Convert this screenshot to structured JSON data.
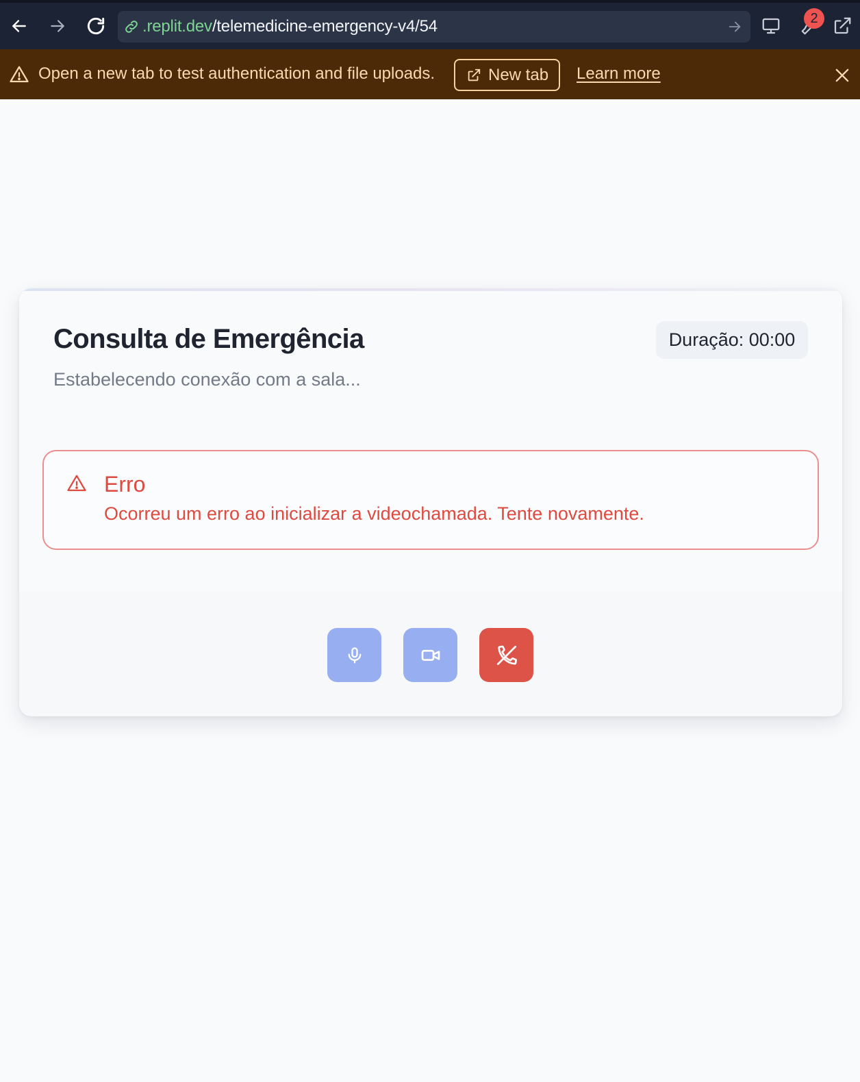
{
  "browser": {
    "url_domain": ".replit.dev",
    "url_path": "/telemedicine-emergency-v4/54",
    "devtools_badge": "2"
  },
  "banner": {
    "message": "Open a new tab to test authentication and file uploads.",
    "new_tab_label": "New tab",
    "learn_more_label": "Learn more"
  },
  "card": {
    "title": "Consulta de Emergência",
    "subtitle": "Estabelecendo conexão com a sala...",
    "duration": "Duração: 00:00"
  },
  "error": {
    "title": "Erro",
    "message": "Ocorreu um erro ao inicializar a videochamada. Tente novamente."
  },
  "controls": [
    {
      "icon": "microphone-icon"
    },
    {
      "icon": "video-camera-icon"
    },
    {
      "icon": "phone-off-icon"
    }
  ],
  "colors": {
    "toolbar_bg": "#1c2334",
    "banner_bg": "#4d2a07",
    "banner_text": "#f8d9b0",
    "url_domain": "#7ed492",
    "error": "#dd4a40",
    "control_blue": "#97aff0",
    "control_red": "#de5348",
    "badge": "#ef5350"
  }
}
